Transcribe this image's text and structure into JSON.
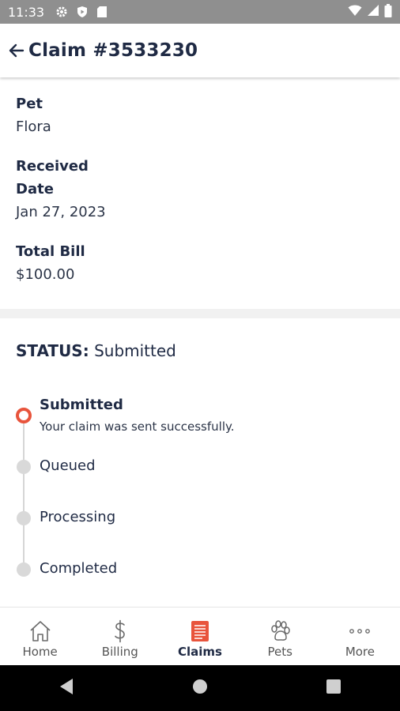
{
  "status_bar": {
    "time": "11:33"
  },
  "header": {
    "title": "Claim #3533230"
  },
  "details": {
    "pet": {
      "label": "Pet",
      "value": "Flora"
    },
    "received_date": {
      "label_line1": "Received",
      "label_line2": "Date",
      "value": "Jan 27, 2023"
    },
    "total_bill": {
      "label": "Total Bill",
      "value": "$100.00"
    }
  },
  "status": {
    "prefix": "STATUS:",
    "value": "Submitted",
    "steps": [
      {
        "title": "Submitted",
        "description": "Your claim was sent successfully.",
        "state": "active"
      },
      {
        "title": "Queued",
        "state": "pending"
      },
      {
        "title": "Processing",
        "state": "pending"
      },
      {
        "title": "Completed",
        "state": "pending"
      }
    ]
  },
  "bottom_nav": [
    {
      "label": "Home",
      "icon": "home-icon",
      "active": false
    },
    {
      "label": "Billing",
      "icon": "dollar-icon",
      "active": false
    },
    {
      "label": "Claims",
      "icon": "document-icon",
      "active": true
    },
    {
      "label": "Pets",
      "icon": "paw-icon",
      "active": false
    },
    {
      "label": "More",
      "icon": "more-icon",
      "active": false
    }
  ],
  "colors": {
    "accent": "#e8543c",
    "text": "#1f2a44",
    "statusbar": "#8f8f8f"
  }
}
